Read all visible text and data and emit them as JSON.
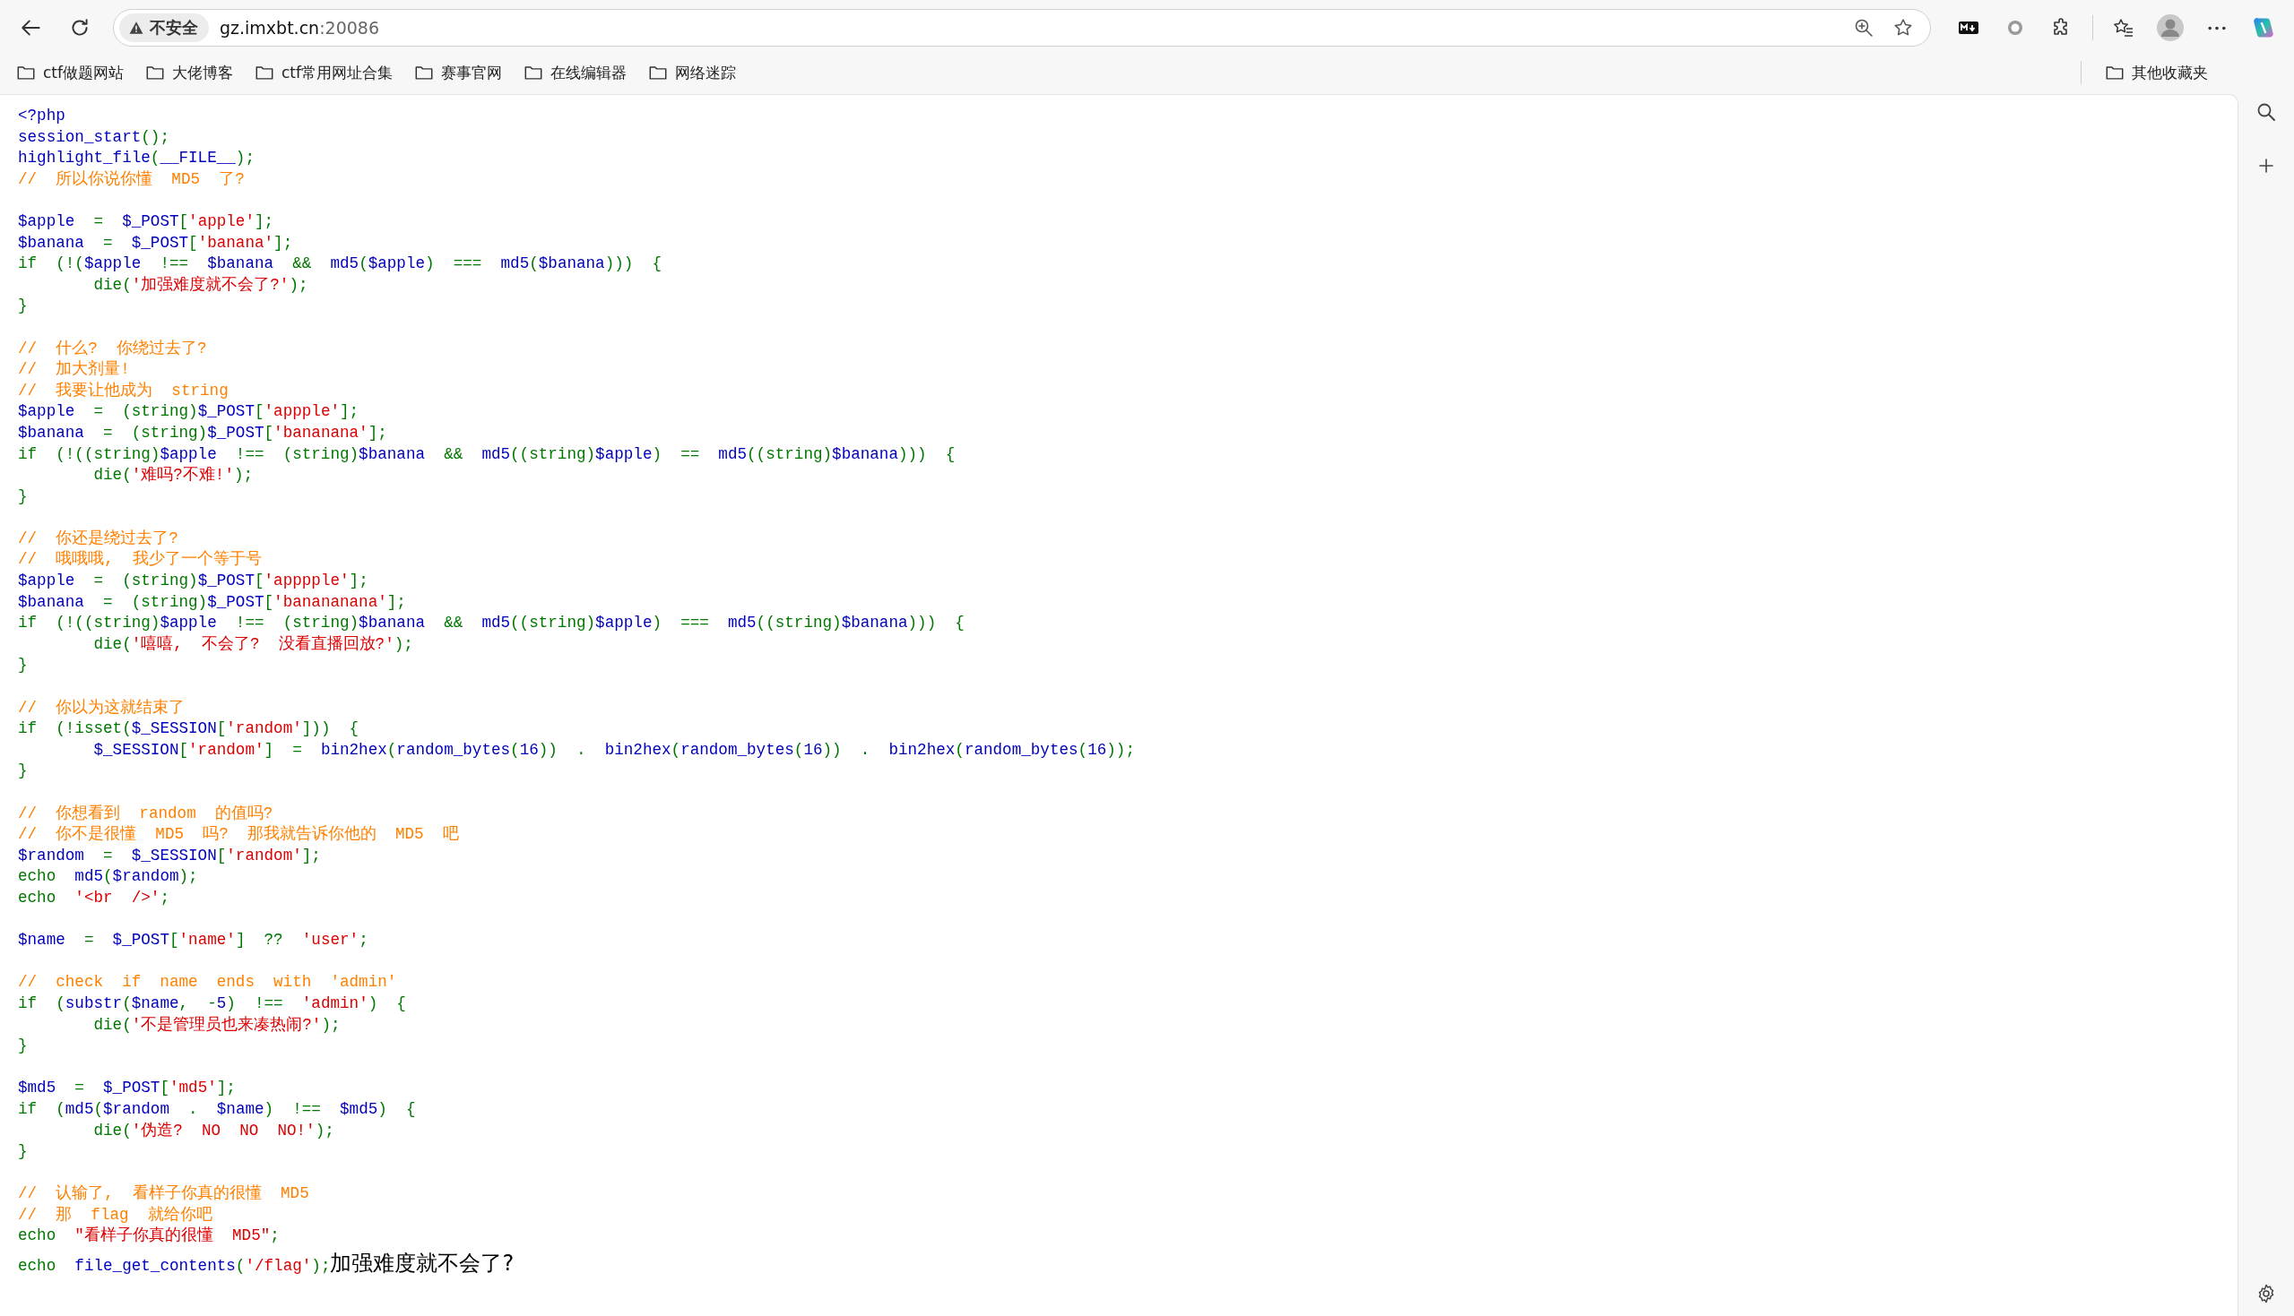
{
  "address_bar": {
    "security_label": "不安全",
    "host": "gz.imxbt.cn",
    "port": ":20086"
  },
  "bookmarks": [
    "ctf做题网站",
    "大佬博客",
    "ctf常用网址合集",
    "赛事官网",
    "在线编辑器",
    "网络迷踪"
  ],
  "other_bookmarks": "其他收藏夹",
  "code_blocks": [
    [
      [
        {
          "kind": "default",
          "text": "<?php"
        }
      ],
      [
        {
          "kind": "default",
          "text": "session_start"
        },
        {
          "kind": "keyword",
          "text": "();"
        }
      ],
      [
        {
          "kind": "default",
          "text": "highlight_file"
        },
        {
          "kind": "keyword",
          "text": "("
        },
        {
          "kind": "default",
          "text": "__FILE__"
        },
        {
          "kind": "keyword",
          "text": ");"
        }
      ],
      [
        {
          "kind": "comment",
          "text": "//  所以你说你懂  MD5  了?"
        }
      ]
    ],
    [
      [
        {
          "kind": "default",
          "text": "$apple"
        },
        {
          "kind": "keyword",
          "text": "  =  "
        },
        {
          "kind": "default",
          "text": "$_POST"
        },
        {
          "kind": "keyword",
          "text": "["
        },
        {
          "kind": "string",
          "text": "'apple'"
        },
        {
          "kind": "keyword",
          "text": "];"
        }
      ],
      [
        {
          "kind": "default",
          "text": "$banana"
        },
        {
          "kind": "keyword",
          "text": "  =  "
        },
        {
          "kind": "default",
          "text": "$_POST"
        },
        {
          "kind": "keyword",
          "text": "["
        },
        {
          "kind": "string",
          "text": "'banana'"
        },
        {
          "kind": "keyword",
          "text": "];"
        }
      ],
      [
        {
          "kind": "keyword",
          "text": "if  (!("
        },
        {
          "kind": "default",
          "text": "$apple  "
        },
        {
          "kind": "keyword",
          "text": "!==  "
        },
        {
          "kind": "default",
          "text": "$banana  "
        },
        {
          "kind": "keyword",
          "text": "&&  "
        },
        {
          "kind": "default",
          "text": "md5"
        },
        {
          "kind": "keyword",
          "text": "("
        },
        {
          "kind": "default",
          "text": "$apple"
        },
        {
          "kind": "keyword",
          "text": ")  ===  "
        },
        {
          "kind": "default",
          "text": "md5"
        },
        {
          "kind": "keyword",
          "text": "("
        },
        {
          "kind": "default",
          "text": "$banana"
        },
        {
          "kind": "keyword",
          "text": ")))  {"
        }
      ],
      [
        {
          "kind": "keyword",
          "text": "        die("
        },
        {
          "kind": "string",
          "text": "'加强难度就不会了?'"
        },
        {
          "kind": "keyword",
          "text": ");"
        }
      ],
      [
        {
          "kind": "keyword",
          "text": "}"
        }
      ]
    ],
    [
      [
        {
          "kind": "comment",
          "text": "//  什么?  你绕过去了?"
        }
      ],
      [
        {
          "kind": "comment",
          "text": "//  加大剂量!"
        }
      ],
      [
        {
          "kind": "comment",
          "text": "//  我要让他成为  string"
        }
      ],
      [
        {
          "kind": "default",
          "text": "$apple"
        },
        {
          "kind": "keyword",
          "text": "  =  (string)"
        },
        {
          "kind": "default",
          "text": "$_POST"
        },
        {
          "kind": "keyword",
          "text": "["
        },
        {
          "kind": "string",
          "text": "'appple'"
        },
        {
          "kind": "keyword",
          "text": "];"
        }
      ],
      [
        {
          "kind": "default",
          "text": "$banana"
        },
        {
          "kind": "keyword",
          "text": "  =  (string)"
        },
        {
          "kind": "default",
          "text": "$_POST"
        },
        {
          "kind": "keyword",
          "text": "["
        },
        {
          "kind": "string",
          "text": "'bananana'"
        },
        {
          "kind": "keyword",
          "text": "];"
        }
      ],
      [
        {
          "kind": "keyword",
          "text": "if  (!((string)"
        },
        {
          "kind": "default",
          "text": "$apple  "
        },
        {
          "kind": "keyword",
          "text": "!==  (string)"
        },
        {
          "kind": "default",
          "text": "$banana  "
        },
        {
          "kind": "keyword",
          "text": "&&  "
        },
        {
          "kind": "default",
          "text": "md5"
        },
        {
          "kind": "keyword",
          "text": "((string)"
        },
        {
          "kind": "default",
          "text": "$apple"
        },
        {
          "kind": "keyword",
          "text": ")  ==  "
        },
        {
          "kind": "default",
          "text": "md5"
        },
        {
          "kind": "keyword",
          "text": "((string)"
        },
        {
          "kind": "default",
          "text": "$banana"
        },
        {
          "kind": "keyword",
          "text": ")))  {"
        }
      ],
      [
        {
          "kind": "keyword",
          "text": "        die("
        },
        {
          "kind": "string",
          "text": "'难吗?不难!'"
        },
        {
          "kind": "keyword",
          "text": ");"
        }
      ],
      [
        {
          "kind": "keyword",
          "text": "}"
        }
      ]
    ],
    [
      [
        {
          "kind": "comment",
          "text": "//  你还是绕过去了?"
        }
      ],
      [
        {
          "kind": "comment",
          "text": "//  哦哦哦,  我少了一个等于号"
        }
      ],
      [
        {
          "kind": "default",
          "text": "$apple"
        },
        {
          "kind": "keyword",
          "text": "  =  (string)"
        },
        {
          "kind": "default",
          "text": "$_POST"
        },
        {
          "kind": "keyword",
          "text": "["
        },
        {
          "kind": "string",
          "text": "'apppple'"
        },
        {
          "kind": "keyword",
          "text": "];"
        }
      ],
      [
        {
          "kind": "default",
          "text": "$banana"
        },
        {
          "kind": "keyword",
          "text": "  =  (string)"
        },
        {
          "kind": "default",
          "text": "$_POST"
        },
        {
          "kind": "keyword",
          "text": "["
        },
        {
          "kind": "string",
          "text": "'banananana'"
        },
        {
          "kind": "keyword",
          "text": "];"
        }
      ],
      [
        {
          "kind": "keyword",
          "text": "if  (!((string)"
        },
        {
          "kind": "default",
          "text": "$apple  "
        },
        {
          "kind": "keyword",
          "text": "!==  (string)"
        },
        {
          "kind": "default",
          "text": "$banana  "
        },
        {
          "kind": "keyword",
          "text": "&&  "
        },
        {
          "kind": "default",
          "text": "md5"
        },
        {
          "kind": "keyword",
          "text": "((string)"
        },
        {
          "kind": "default",
          "text": "$apple"
        },
        {
          "kind": "keyword",
          "text": ")  ===  "
        },
        {
          "kind": "default",
          "text": "md5"
        },
        {
          "kind": "keyword",
          "text": "((string)"
        },
        {
          "kind": "default",
          "text": "$banana"
        },
        {
          "kind": "keyword",
          "text": ")))  {"
        }
      ],
      [
        {
          "kind": "keyword",
          "text": "        die("
        },
        {
          "kind": "string",
          "text": "'嘻嘻,  不会了?  没看直播回放?'"
        },
        {
          "kind": "keyword",
          "text": ");"
        }
      ],
      [
        {
          "kind": "keyword",
          "text": "}"
        }
      ]
    ],
    [
      [
        {
          "kind": "comment",
          "text": "//  你以为这就结束了"
        }
      ],
      [
        {
          "kind": "keyword",
          "text": "if  (!isset("
        },
        {
          "kind": "default",
          "text": "$_SESSION"
        },
        {
          "kind": "keyword",
          "text": "["
        },
        {
          "kind": "string",
          "text": "'random'"
        },
        {
          "kind": "keyword",
          "text": "]))  {"
        }
      ],
      [
        {
          "kind": "default",
          "text": "        $_SESSION"
        },
        {
          "kind": "keyword",
          "text": "["
        },
        {
          "kind": "string",
          "text": "'random'"
        },
        {
          "kind": "keyword",
          "text": "]  =  "
        },
        {
          "kind": "default",
          "text": "bin2hex"
        },
        {
          "kind": "keyword",
          "text": "("
        },
        {
          "kind": "default",
          "text": "random_bytes"
        },
        {
          "kind": "keyword",
          "text": "("
        },
        {
          "kind": "default",
          "text": "16"
        },
        {
          "kind": "keyword",
          "text": "))  .  "
        },
        {
          "kind": "default",
          "text": "bin2hex"
        },
        {
          "kind": "keyword",
          "text": "("
        },
        {
          "kind": "default",
          "text": "random_bytes"
        },
        {
          "kind": "keyword",
          "text": "("
        },
        {
          "kind": "default",
          "text": "16"
        },
        {
          "kind": "keyword",
          "text": "))  .  "
        },
        {
          "kind": "default",
          "text": "bin2hex"
        },
        {
          "kind": "keyword",
          "text": "("
        },
        {
          "kind": "default",
          "text": "random_bytes"
        },
        {
          "kind": "keyword",
          "text": "("
        },
        {
          "kind": "default",
          "text": "16"
        },
        {
          "kind": "keyword",
          "text": "));"
        }
      ],
      [
        {
          "kind": "keyword",
          "text": "}"
        }
      ]
    ],
    [
      [
        {
          "kind": "comment",
          "text": "//  你想看到  random  的值吗?"
        }
      ],
      [
        {
          "kind": "comment",
          "text": "//  你不是很懂  MD5  吗?  那我就告诉你他的  MD5  吧"
        }
      ],
      [
        {
          "kind": "default",
          "text": "$random"
        },
        {
          "kind": "keyword",
          "text": "  =  "
        },
        {
          "kind": "default",
          "text": "$_SESSION"
        },
        {
          "kind": "keyword",
          "text": "["
        },
        {
          "kind": "string",
          "text": "'random'"
        },
        {
          "kind": "keyword",
          "text": "];"
        }
      ],
      [
        {
          "kind": "keyword",
          "text": "echo  "
        },
        {
          "kind": "default",
          "text": "md5"
        },
        {
          "kind": "keyword",
          "text": "("
        },
        {
          "kind": "default",
          "text": "$random"
        },
        {
          "kind": "keyword",
          "text": ");"
        }
      ],
      [
        {
          "kind": "keyword",
          "text": "echo  "
        },
        {
          "kind": "string",
          "text": "'<br  />'"
        },
        {
          "kind": "keyword",
          "text": ";"
        }
      ]
    ],
    [
      [
        {
          "kind": "default",
          "text": "$name"
        },
        {
          "kind": "keyword",
          "text": "  =  "
        },
        {
          "kind": "default",
          "text": "$_POST"
        },
        {
          "kind": "keyword",
          "text": "["
        },
        {
          "kind": "string",
          "text": "'name'"
        },
        {
          "kind": "keyword",
          "text": "]  ??  "
        },
        {
          "kind": "string",
          "text": "'user'"
        },
        {
          "kind": "keyword",
          "text": ";"
        }
      ]
    ],
    [
      [
        {
          "kind": "comment",
          "text": "//  check  if  name  ends  with  'admin'"
        }
      ],
      [
        {
          "kind": "keyword",
          "text": "if  ("
        },
        {
          "kind": "default",
          "text": "substr"
        },
        {
          "kind": "keyword",
          "text": "("
        },
        {
          "kind": "default",
          "text": "$name"
        },
        {
          "kind": "keyword",
          "text": ",  -"
        },
        {
          "kind": "default",
          "text": "5"
        },
        {
          "kind": "keyword",
          "text": ")  !==  "
        },
        {
          "kind": "string",
          "text": "'admin'"
        },
        {
          "kind": "keyword",
          "text": ")  {"
        }
      ],
      [
        {
          "kind": "keyword",
          "text": "        die("
        },
        {
          "kind": "string",
          "text": "'不是管理员也来凑热闹?'"
        },
        {
          "kind": "keyword",
          "text": ");"
        }
      ],
      [
        {
          "kind": "keyword",
          "text": "}"
        }
      ]
    ],
    [
      [
        {
          "kind": "default",
          "text": "$md5"
        },
        {
          "kind": "keyword",
          "text": "  =  "
        },
        {
          "kind": "default",
          "text": "$_POST"
        },
        {
          "kind": "keyword",
          "text": "["
        },
        {
          "kind": "string",
          "text": "'md5'"
        },
        {
          "kind": "keyword",
          "text": "];"
        }
      ],
      [
        {
          "kind": "keyword",
          "text": "if  ("
        },
        {
          "kind": "default",
          "text": "md5"
        },
        {
          "kind": "keyword",
          "text": "("
        },
        {
          "kind": "default",
          "text": "$random  "
        },
        {
          "kind": "keyword",
          "text": ".  "
        },
        {
          "kind": "default",
          "text": "$name"
        },
        {
          "kind": "keyword",
          "text": ")  !==  "
        },
        {
          "kind": "default",
          "text": "$md5"
        },
        {
          "kind": "keyword",
          "text": ")  {"
        }
      ],
      [
        {
          "kind": "keyword",
          "text": "        die("
        },
        {
          "kind": "string",
          "text": "'伪造?  NO  NO  NO!'"
        },
        {
          "kind": "keyword",
          "text": ");"
        }
      ],
      [
        {
          "kind": "keyword",
          "text": "}"
        }
      ]
    ],
    [
      [
        {
          "kind": "comment",
          "text": "//  认输了,  看样子你真的很懂  MD5"
        }
      ],
      [
        {
          "kind": "comment",
          "text": "//  那  flag  就给你吧"
        }
      ],
      [
        {
          "kind": "keyword",
          "text": "echo  "
        },
        {
          "kind": "string",
          "text": "\"看样子你真的很懂  MD5\""
        },
        {
          "kind": "keyword",
          "text": ";"
        }
      ],
      [
        {
          "kind": "keyword",
          "text": "echo  "
        },
        {
          "kind": "default",
          "text": "file_get_contents"
        },
        {
          "kind": "keyword",
          "text": "("
        },
        {
          "kind": "string",
          "text": "'/flag'"
        },
        {
          "kind": "keyword",
          "text": ");"
        }
      ]
    ]
  ],
  "output_text": "加强难度就不会了?"
}
